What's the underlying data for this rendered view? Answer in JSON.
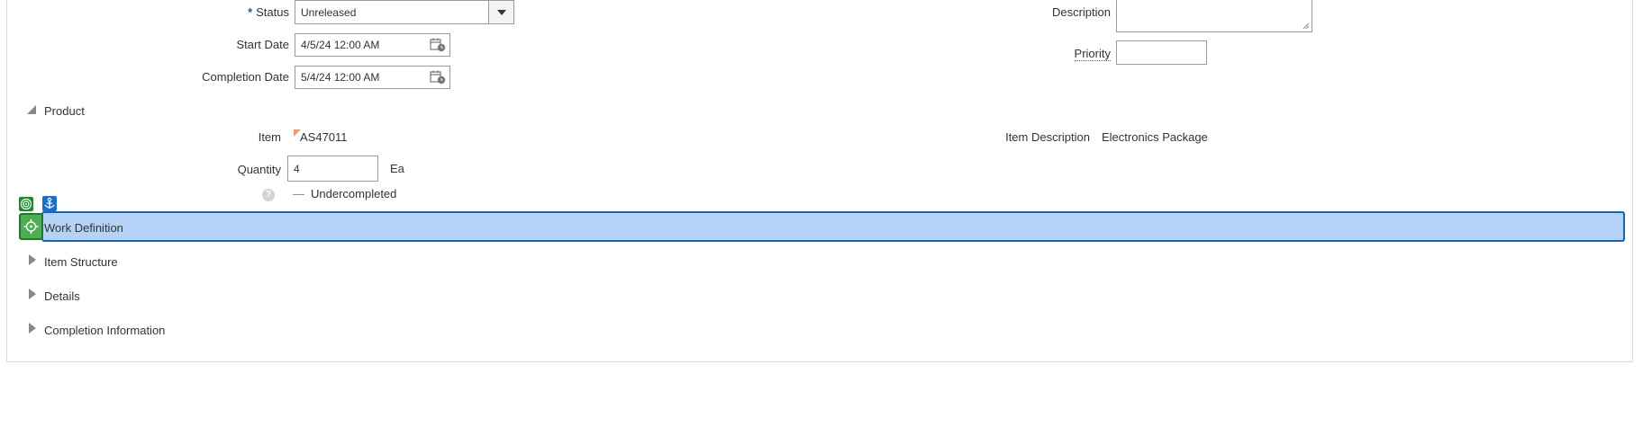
{
  "header_fields": {
    "status": {
      "required_mark": "*",
      "label": "Status",
      "value": "Unreleased"
    },
    "start_date": {
      "label": "Start Date",
      "value": "4/5/24 12:00 AM"
    },
    "completion_date": {
      "label": "Completion Date",
      "value": "5/4/24 12:00 AM"
    },
    "description": {
      "label": "Description",
      "value": ""
    },
    "priority": {
      "label": "Priority",
      "value": ""
    }
  },
  "product": {
    "title": "Product",
    "item_label": "Item",
    "item_value": "AS47011",
    "item_description_label": "Item Description",
    "item_description_value": "Electronics Package",
    "quantity_label": "Quantity",
    "quantity_value": "4",
    "uom": "Ea",
    "help_glyph": "?",
    "status_dash": "—",
    "status_text": "Undercompleted"
  },
  "sections": {
    "work_definition": "Work Definition",
    "item_structure": "Item Structure",
    "details": "Details",
    "completion_information": "Completion Information"
  },
  "icons": {
    "dropdown": "chevron-down-icon",
    "calendar": "calendar-icon",
    "target": "target-icon",
    "anchor": "anchor-icon",
    "crosshair": "crosshair-icon"
  },
  "colors": {
    "highlight_fill": "#b4d3f7",
    "highlight_border": "#1a64b8",
    "green_badge": "#1f8a2c",
    "blue_badge": "#1a6fd1",
    "required": "#1b5c9a"
  }
}
